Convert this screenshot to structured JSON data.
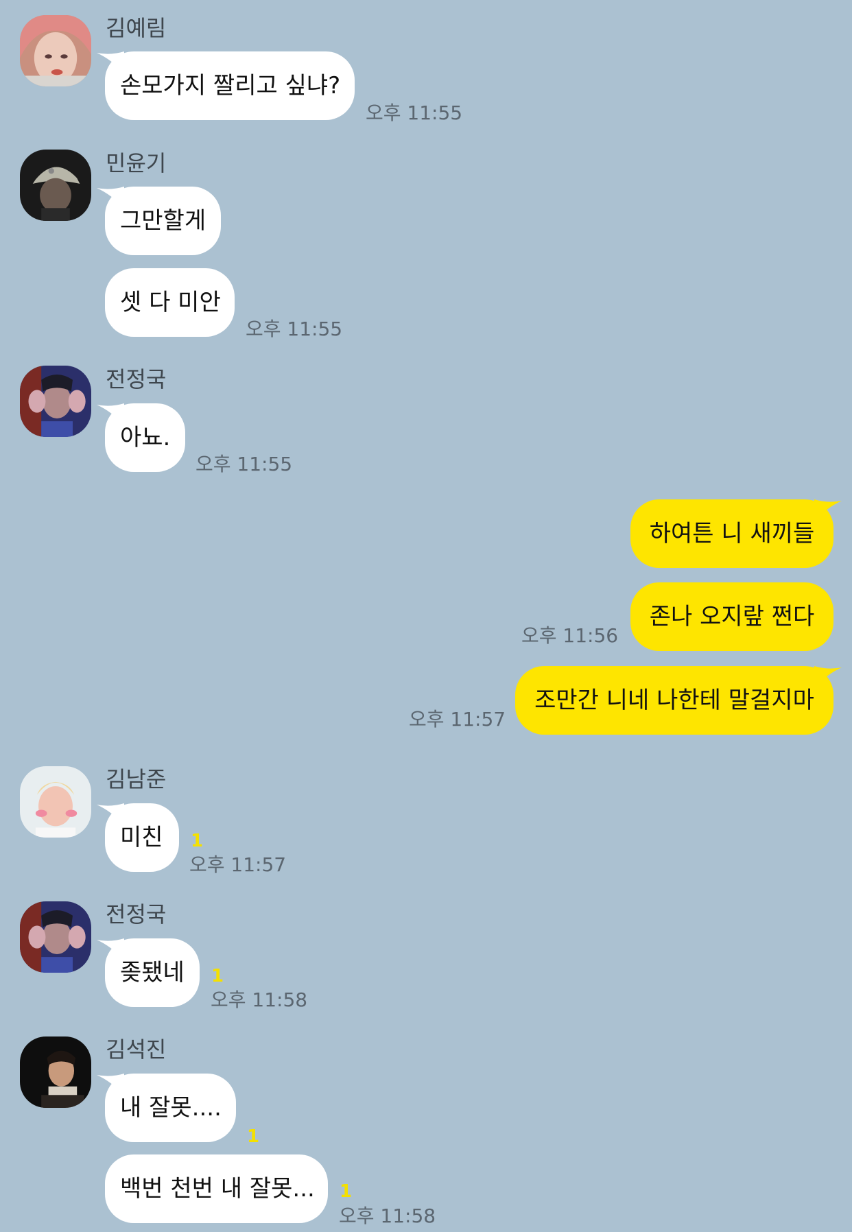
{
  "colors": {
    "background": "#abc1d1",
    "incoming_bubble": "#ffffff",
    "outgoing_bubble": "#fee500",
    "unread_count": "#f4e000",
    "timestamp": "#5b6670"
  },
  "messages": {
    "m1": {
      "sender": "김예림",
      "text": "손모가지 짤리고 싶냐?",
      "time": "오후 11:55"
    },
    "m2": {
      "sender": "민윤기",
      "text1": "그만할게",
      "text2": "셋 다 미안",
      "time": "오후 11:55"
    },
    "m3": {
      "sender": "전정국",
      "text": "아뇨.",
      "time": "오후 11:55"
    },
    "me": {
      "text1": "하여튼 니 새끼들",
      "text2": "존나 오지랖 쩐다",
      "time2": "오후 11:56",
      "text3": "조만간 니네 나한테 말걸지마",
      "time3": "오후 11:57"
    },
    "m4": {
      "sender": "김남준",
      "text": "미친",
      "unread": "1",
      "time": "오후 11:57"
    },
    "m5": {
      "sender": "전정국",
      "text": "좆됐네",
      "unread": "1",
      "time": "오후 11:58"
    },
    "m6": {
      "sender": "김석진",
      "text1": "내 잘못....",
      "unread1": "1",
      "text2": "백번 천번 내 잘못...",
      "unread2": "1",
      "time": "오후 11:58"
    }
  },
  "avatars": {
    "m1": "avatar-pink-hair-photo",
    "m2": "avatar-cap-photo",
    "m3": "avatar-hands-photo",
    "m4": "avatar-blond-photo",
    "m5": "avatar-hands-photo",
    "m6": "avatar-dark-portrait-photo"
  }
}
